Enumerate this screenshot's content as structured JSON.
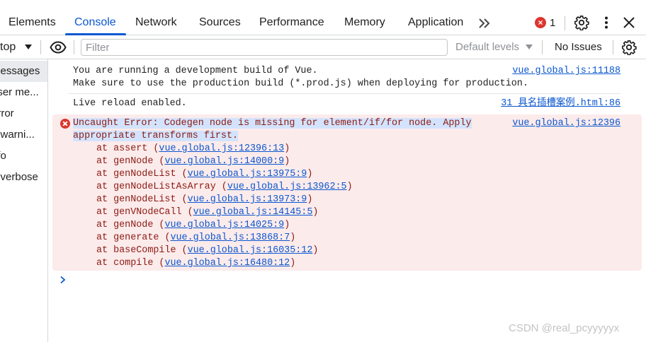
{
  "tabs": {
    "items": [
      "Elements",
      "Console",
      "Network",
      "Sources",
      "Performance",
      "Memory",
      "Application"
    ],
    "active": "Console",
    "error_count": "1"
  },
  "toolbar": {
    "context": "top",
    "filter_placeholder": "Filter",
    "levels": "Default levels",
    "issues": "No Issues"
  },
  "sidebar": {
    "items": [
      "messages",
      "user me...",
      "error",
      "o warni...",
      "nfo",
      "o verbose"
    ],
    "active_index": 0
  },
  "console": {
    "messages": [
      {
        "lines": [
          "You are running a development build of Vue.",
          "Make sure to use the production build (*.prod.js) when deploying for production."
        ],
        "source": "vue.global.js:11188"
      },
      {
        "lines": [
          "Live reload enabled."
        ],
        "source": "31 具名插槽案例.html:86"
      }
    ],
    "error": {
      "lines": [
        "Uncaught Error: Codegen node is missing for element/if/for node. Apply",
        "appropriate transforms first."
      ],
      "source": "vue.global.js:12396",
      "stack": [
        {
          "fn": "at assert",
          "loc": "vue.global.js:12396:13"
        },
        {
          "fn": "at genNode",
          "loc": "vue.global.js:14000:9"
        },
        {
          "fn": "at genNodeList",
          "loc": "vue.global.js:13975:9"
        },
        {
          "fn": "at genNodeListAsArray",
          "loc": "vue.global.js:13962:5"
        },
        {
          "fn": "at genNodeList",
          "loc": "vue.global.js:13973:9"
        },
        {
          "fn": "at genVNodeCall",
          "loc": "vue.global.js:14145:5"
        },
        {
          "fn": "at genNode",
          "loc": "vue.global.js:14025:9"
        },
        {
          "fn": "at generate",
          "loc": "vue.global.js:13868:7"
        },
        {
          "fn": "at baseCompile",
          "loc": "vue.global.js:16035:12"
        },
        {
          "fn": "at compile",
          "loc": "vue.global.js:16480:12"
        }
      ]
    }
  },
  "watermark": "CSDN @real_pcyyyyyx",
  "colors": {
    "accent": "#0b57d0",
    "error_bg": "#fcebeb",
    "error_text": "#8b1b13",
    "error_icon": "#dc362e"
  },
  "icons": [
    "more-tabs-icon",
    "error-badge-icon",
    "settings-gear-icon",
    "kebab-menu-icon",
    "close-icon",
    "dropdown-caret-icon",
    "eye-icon",
    "error-circle-icon",
    "chevron-right-icon"
  ]
}
